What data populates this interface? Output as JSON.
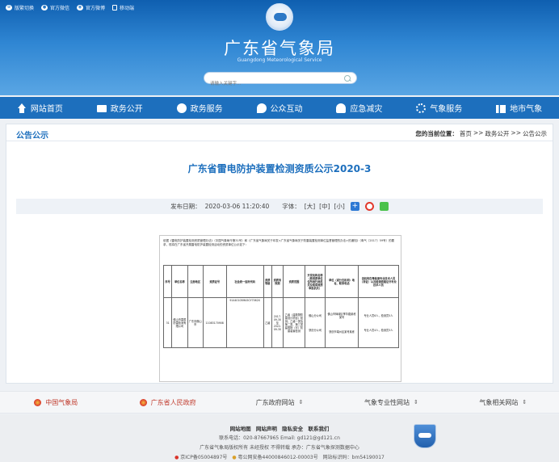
{
  "header": {
    "top_links": [
      {
        "icon": "accessibility-icon",
        "label": "版繁切换"
      },
      {
        "icon": "wechat-icon",
        "label": "官方微信"
      },
      {
        "icon": "weibo-icon",
        "label": "官方微博"
      },
      {
        "icon": "mobile-icon",
        "label": "移动端"
      }
    ],
    "site_title": "广东省气象局",
    "site_subtitle": "Guangdong Meteorological Service",
    "search_placeholder": "请输入关键字..."
  },
  "nav": {
    "items": [
      {
        "label": "网站首页",
        "icon": "home-icon"
      },
      {
        "label": "政务公开",
        "icon": "mail-icon"
      },
      {
        "label": "政务服务",
        "icon": "globe-icon"
      },
      {
        "label": "公众互动",
        "icon": "chat-icon"
      },
      {
        "label": "应急减灾",
        "icon": "bell-icon"
      },
      {
        "label": "气象服务",
        "icon": "weather-icon"
      },
      {
        "label": "地市气象",
        "icon": "city-icon"
      }
    ]
  },
  "page": {
    "section_title": "公告公示",
    "breadcrumb": {
      "label": "您的当前位置：",
      "items": [
        "首页",
        "政务公开",
        "公告公示"
      ],
      "sep": ">>"
    },
    "article_title": "广东省雷电防护装置检测资质公示2020-3",
    "meta": {
      "date_label": "发布日期：",
      "date": "2020-03-06 11:20:40",
      "font_label": "字体：",
      "font_large": "[大]",
      "font_medium": "[中]",
      "font_small": "[小]"
    },
    "document": {
      "intro": "依据《雷电防护装置检测资质管理办法》（中国气象局令第31号）和《广东省气象局关于印发<广东省气象局关于防雷装置检测单位监督管理的办法>的通知》（粤气〔2017〕59号）的要求，现将在广东省开展雷电防护装置检测活动的资质单位公示如下：",
      "headers": [
        "序号",
        "单位名称",
        "注册地区",
        "资质证号",
        "社会统一信用代码",
        "资质等级",
        "资质有效期",
        "资质范围",
        "开发机构名称（原资质单位住所地行政机关及取得资质审批机关）",
        "单位（或分支机构）地址、联系电话",
        "该机构在粤检测专业技术人员（持证）以及检测资格证书专业技术人员"
      ],
      "row": {
        "no": "31",
        "name": "佛山市雷盾防雷检测有限公司",
        "region": "广东省佛山市",
        "cert": "11083170908",
        "credit": "91440105MA5CY7062X",
        "level": "乙级",
        "validity": "2017-09-30至2022-09-30",
        "scope": "乙级（建筑物防雷设计项目）检测；乙级一类及第二类、第三类建筑物（可）防雷装置检测",
        "office_a": "佛山分公司",
        "office_b": "肇庆分公司",
        "addr_a": "佛山市禅城区季华路某栋某号",
        "addr_b": "肇庆市端州区某号某栋",
        "staff_a": "专业人员6人，检测员5人",
        "staff_b": "专业人员4人，检测员3人"
      }
    }
  },
  "footer": {
    "links": [
      {
        "label": "中国气象局",
        "icon": "cma-icon",
        "red": true,
        "dropdown": false
      },
      {
        "label": "广东省人民政府",
        "icon": "gov-icon",
        "red": true,
        "dropdown": false
      },
      {
        "label": "广东政府网站",
        "icon": "",
        "red": false,
        "dropdown": true
      },
      {
        "label": "气象专业性网站",
        "icon": "",
        "red": false,
        "dropdown": true
      },
      {
        "label": "气象相关网站",
        "icon": "",
        "red": false,
        "dropdown": true
      }
    ],
    "nav": [
      "网站地图",
      "网站声明",
      "隐私安全",
      "联系我们"
    ],
    "contact": "联系电话：020-87667965  Email: gd121@gd121.cn",
    "copyright": "广东省气象局版权所有 未经授权 不得转载  承办：广东省气象探测数据中心",
    "icp": "京ICP备05004897号",
    "police": "粤公网安备44000846012-00003号",
    "site_code": "网站标识码：bm54190017"
  }
}
